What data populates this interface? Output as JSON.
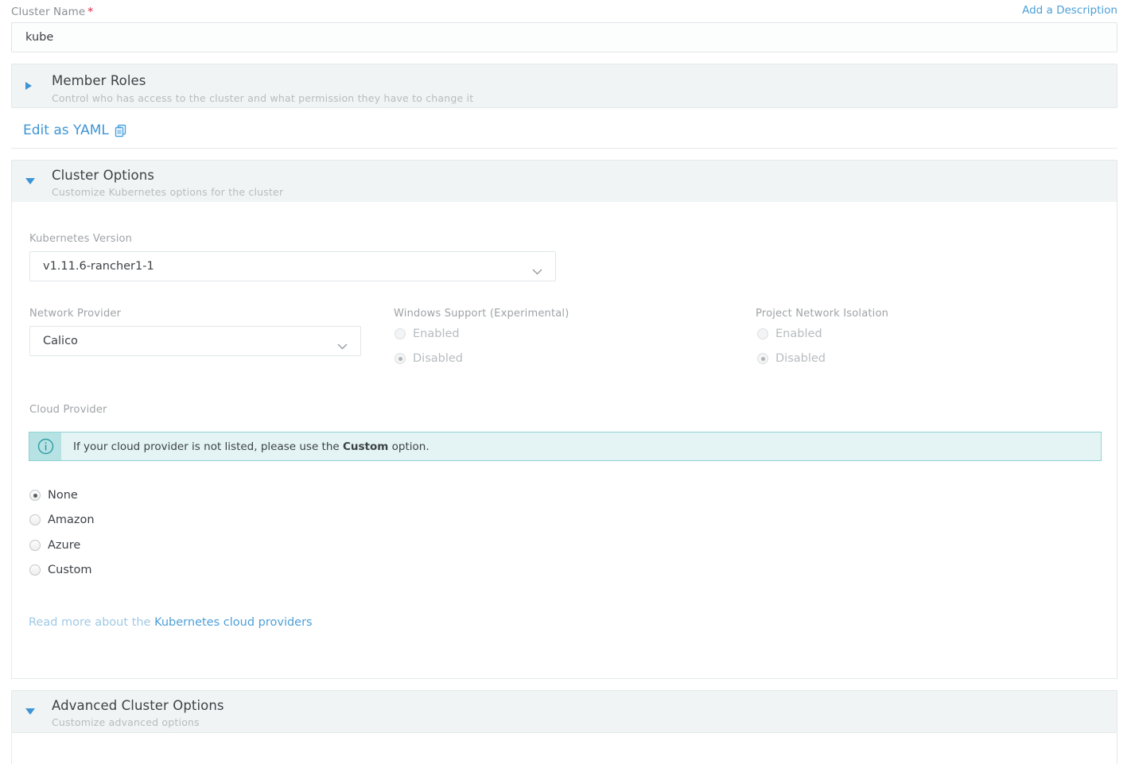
{
  "cluster_name": {
    "label": "Cluster Name",
    "required_marker": "*",
    "value": "kube",
    "add_description_link": "Add a Description"
  },
  "member_roles": {
    "title": "Member Roles",
    "subtitle": "Control who has access to the cluster and what permission they have to change it",
    "expanded": false
  },
  "yaml": {
    "label": "Edit as YAML",
    "icon": "clipboard-icon"
  },
  "cluster_options": {
    "title": "Cluster Options",
    "subtitle": "Customize Kubernetes options for the cluster",
    "expanded": true,
    "kubernetes_version": {
      "label": "Kubernetes Version",
      "value": "v1.11.6-rancher1-1"
    },
    "network_provider": {
      "label": "Network Provider",
      "value": "Calico"
    },
    "windows_support": {
      "label": "Windows Support (Experimental)",
      "disabled": true,
      "options": [
        "Enabled",
        "Disabled"
      ],
      "selected": "Disabled"
    },
    "project_network_isolation": {
      "label": "Project Network Isolation",
      "disabled": true,
      "options": [
        "Enabled",
        "Disabled"
      ],
      "selected": "Disabled"
    },
    "cloud_provider": {
      "label": "Cloud Provider",
      "notice_prefix": "If your cloud provider is not listed, please use the",
      "notice_bold": "Custom",
      "notice_suffix": "option.",
      "options": [
        "None",
        "Amazon",
        "Azure",
        "Custom"
      ],
      "selected": "None",
      "read_more_text": "Read more about the",
      "read_more_link": "Kubernetes cloud providers"
    }
  },
  "advanced_cluster_options": {
    "title": "Advanced Cluster Options",
    "subtitle": "Customize advanced options",
    "expanded": true
  },
  "colors": {
    "link": "#3d95d6",
    "accent": "#4c9fd8",
    "required": "#e8576f",
    "banner_bg": "#e4f4f4",
    "banner_border": "#8fd3d6",
    "banner_icon_bg": "#b7e2e4",
    "panel_header_bg": "#f0f4f5",
    "text": "#3d4246",
    "muted": "#9ea3a7"
  }
}
